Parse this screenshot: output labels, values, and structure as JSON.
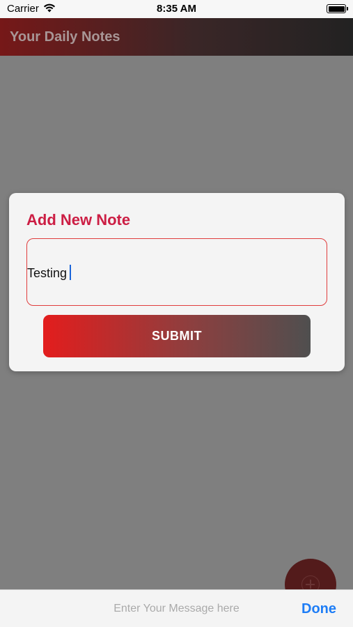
{
  "status_bar": {
    "carrier": "Carrier",
    "time": "8:35 AM",
    "icons": [
      "wifi-icon",
      "battery-icon"
    ]
  },
  "app_bar": {
    "title": "Your Daily Notes"
  },
  "dialog": {
    "heading": "Add New Note",
    "note_value": "Testing",
    "submit_label": "SUBMIT"
  },
  "fab": {
    "icon": "add-icon"
  },
  "keyboard_toolbar": {
    "placeholder": "Enter Your Message here",
    "done_label": "Done"
  },
  "colors": {
    "accent_red": "#cc1e44",
    "input_border": "#e03c3c",
    "done_blue": "#1e7df6",
    "overlay": "#7f7f7f"
  }
}
